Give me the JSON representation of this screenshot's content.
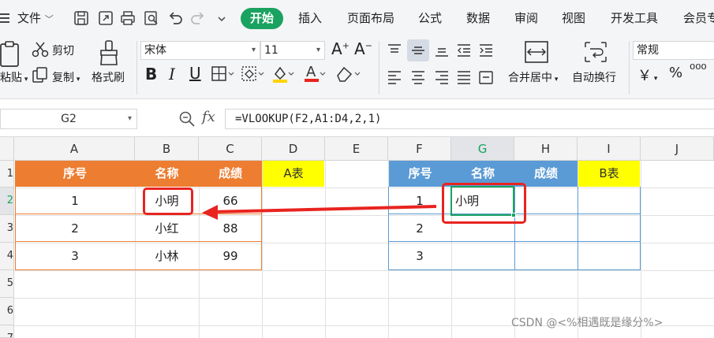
{
  "menu": {
    "file": "文件",
    "tabs": [
      "开始",
      "插入",
      "页面布局",
      "公式",
      "数据",
      "审阅",
      "视图",
      "开发工具",
      "会员专"
    ]
  },
  "ribbon": {
    "paste": "粘贴",
    "cut": "剪切",
    "copy": "复制",
    "format_painter": "格式刷",
    "font_name": "宋体",
    "font_size": "11",
    "merge_center": "合并居中",
    "wrap_text": "自动换行",
    "number_format": "常规",
    "currency_symbol": "￥",
    "percent_symbol": "%",
    "comma_symbol": "⁰⁰⁰"
  },
  "formula_bar": {
    "name_box": "G2",
    "fx": "fx",
    "formula": "=VLOOKUP(F2,A1:D4,2,1)"
  },
  "columns": [
    "A",
    "B",
    "C",
    "D",
    "E",
    "F",
    "G",
    "H",
    "I",
    "J"
  ],
  "rows": [
    "1",
    "2",
    "3",
    "4",
    "5",
    "6",
    "7"
  ],
  "table_a": {
    "headers": [
      "序号",
      "名称",
      "成绩"
    ],
    "label": "A表",
    "rows": [
      [
        "1",
        "小明",
        "66"
      ],
      [
        "2",
        "小红",
        "88"
      ],
      [
        "3",
        "小林",
        "99"
      ]
    ]
  },
  "table_b": {
    "headers": [
      "序号",
      "名称",
      "成绩"
    ],
    "label": "B表",
    "rows": [
      [
        "1",
        "小明",
        ""
      ],
      [
        "2",
        "",
        ""
      ],
      [
        "3",
        "",
        ""
      ]
    ]
  },
  "selected_cell": "G2",
  "watermark": "CSDN @<%相遇既是缘分%>",
  "colors": {
    "accent": "#1aa260",
    "table_a_header": "#ed7d31",
    "table_b_header": "#5b9bd5",
    "label_fill": "#ffff00",
    "annotation": "#e8241f"
  }
}
